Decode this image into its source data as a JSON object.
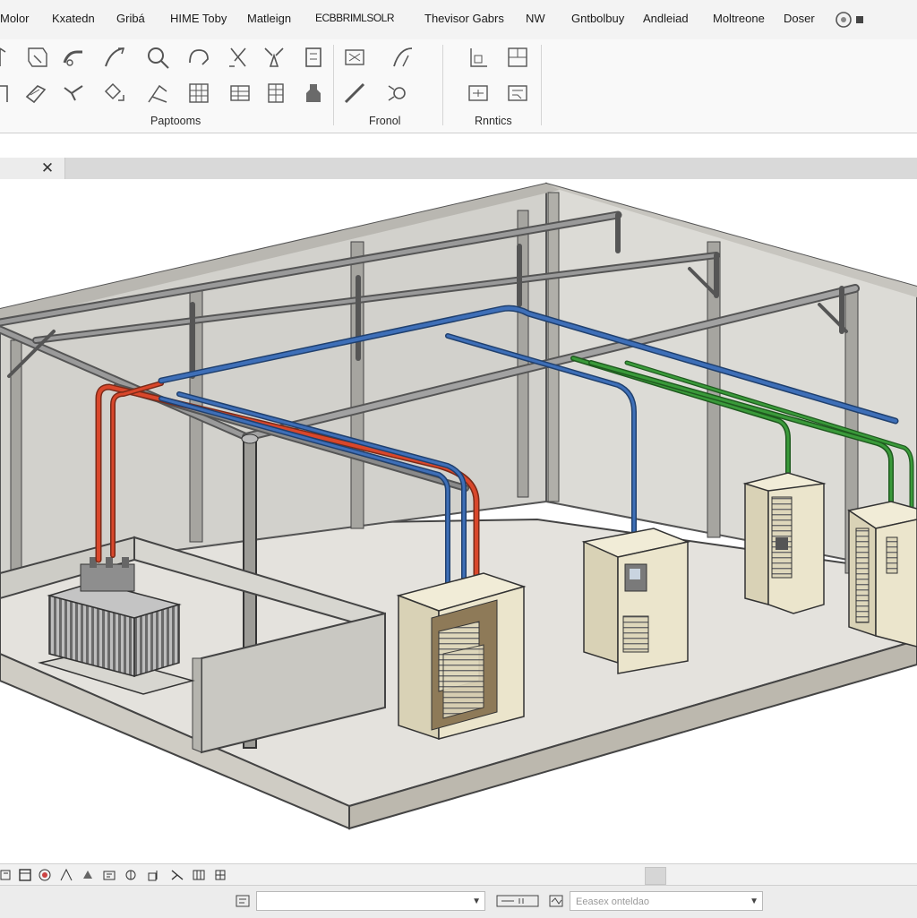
{
  "menu": {
    "items": [
      "Molor",
      "Kxatedn",
      "Gribá",
      "HIME Toby",
      "Matleign",
      "ECBBRIMLSOLR",
      "Thevisor Gabrs",
      "NW",
      "Gntbolbuy",
      "Andleiad",
      "Moltreone",
      "Doser"
    ]
  },
  "ribbon": {
    "groups": [
      "Paptooms",
      "Fronol",
      "Rnntics"
    ],
    "tool_icons": [
      "wall-icon",
      "beam-icon",
      "pipe-bend-icon",
      "cable-tray-icon",
      "conduit-icon",
      "fitting-icon",
      "valve-icon",
      "panel-icon",
      "grid-icon",
      "duct-icon",
      "line-icon",
      "tag-icon"
    ]
  },
  "document_tab": {
    "close_glyph": "✕"
  },
  "scene": {
    "pipe_colors": {
      "red": "#d9472b",
      "blue": "#3e6fb8",
      "green": "#3a9a3a",
      "steel": "#6f6f6f",
      "cabinet": "#e9e3cc",
      "floor": "#e3e1dc",
      "wall": "#d9d8d3"
    }
  },
  "statusbar": {
    "combo_placeholder": "Eeasex onteldao"
  }
}
